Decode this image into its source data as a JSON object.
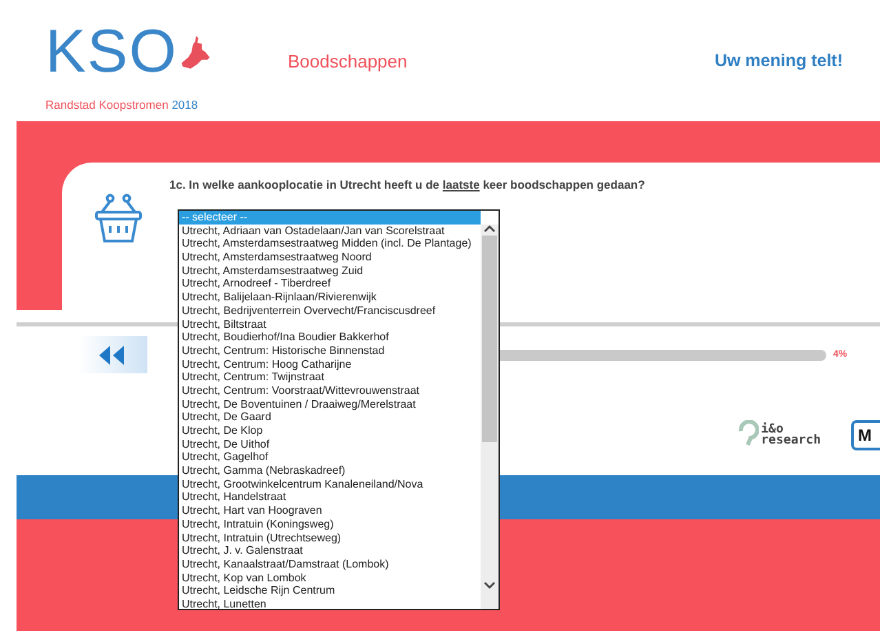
{
  "header": {
    "logo_letters": "KSO",
    "logo_caption": "Randstad Koopstromen",
    "logo_year": "2018",
    "section_title": "Boodschappen",
    "tagline": "Uw mening telt!"
  },
  "question": [
    {
      "text": "1c. In welke aankooplocatie in Utrecht heeft u de ",
      "underlined": false
    },
    {
      "text": "laatste",
      "underlined": true
    },
    {
      "text": " keer boodschappen gedaan?",
      "underlined": false
    }
  ],
  "listbox": {
    "options": [
      {
        "label": "-- selecteer --",
        "selected": true
      },
      {
        "label": "Utrecht, Adriaan van Ostadelaan/Jan van Scorelstraat",
        "selected": false
      },
      {
        "label": "Utrecht, Amsterdamsestraatweg Midden (incl. De Plantage)",
        "selected": false
      },
      {
        "label": "Utrecht, Amsterdamsestraatweg Noord",
        "selected": false
      },
      {
        "label": "Utrecht, Amsterdamsestraatweg Zuid",
        "selected": false
      },
      {
        "label": "Utrecht, Arnodreef - Tiberdreef",
        "selected": false
      },
      {
        "label": "Utrecht, Balijelaan-Rijnlaan/Rivierenwijk",
        "selected": false
      },
      {
        "label": "Utrecht, Bedrijventerrein Overvecht/Franciscusdreef",
        "selected": false
      },
      {
        "label": "Utrecht, Biltstraat",
        "selected": false
      },
      {
        "label": "Utrecht, Boudierhof/Ina Boudier Bakkerhof",
        "selected": false
      },
      {
        "label": "Utrecht, Centrum: Historische Binnenstad",
        "selected": false
      },
      {
        "label": "Utrecht, Centrum: Hoog Catharijne",
        "selected": false
      },
      {
        "label": "Utrecht, Centrum: Twijnstraat",
        "selected": false
      },
      {
        "label": "Utrecht, Centrum: Voorstraat/Wittevrouwenstraat",
        "selected": false
      },
      {
        "label": "Utrecht, De Boventuinen / Draaiweg/Merelstraat",
        "selected": false
      },
      {
        "label": "Utrecht, De Gaard",
        "selected": false
      },
      {
        "label": "Utrecht, De Klop",
        "selected": false
      },
      {
        "label": "Utrecht, De Uithof",
        "selected": false
      },
      {
        "label": "Utrecht, Gagelhof",
        "selected": false
      },
      {
        "label": "Utrecht, Gamma (Nebraskadreef)",
        "selected": false
      },
      {
        "label": "Utrecht, Grootwinkelcentrum Kanaleneiland/Nova",
        "selected": false
      },
      {
        "label": "Utrecht, Handelstraat",
        "selected": false
      },
      {
        "label": "Utrecht, Hart van Hoograven",
        "selected": false
      },
      {
        "label": "Utrecht, Intratuin (Koningsweg)",
        "selected": false
      },
      {
        "label": "Utrecht, Intratuin (Utrechtseweg)",
        "selected": false
      },
      {
        "label": "Utrecht, J. v. Galenstraat",
        "selected": false
      },
      {
        "label": "Utrecht, Kanaalstraat/Damstraat (Lombok)",
        "selected": false
      },
      {
        "label": "Utrecht, Kop van Lombok",
        "selected": false
      },
      {
        "label": "Utrecht, Leidsche Rijn Centrum",
        "selected": false
      },
      {
        "label": "Utrecht, Lunetten",
        "selected": false
      }
    ]
  },
  "progress": {
    "reading": "4%"
  },
  "partners": [
    {
      "kind": "io",
      "line_1": "i&o",
      "line_2": "research"
    },
    {
      "kind": "moa",
      "line_1": "M"
    }
  ]
}
